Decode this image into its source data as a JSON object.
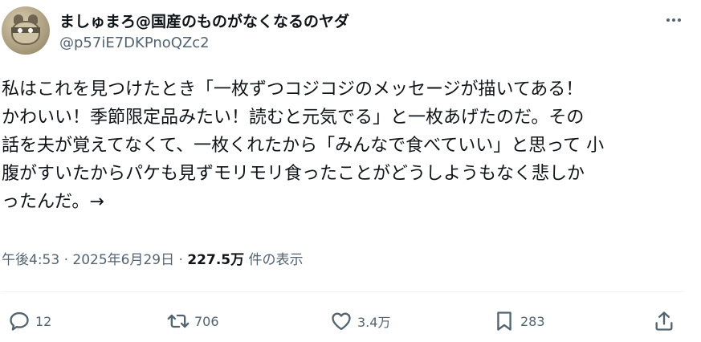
{
  "user": {
    "display_name": "ましゅまろ@国産のものがなくなるのヤダ",
    "handle": "@p57iE7DKPnoQZc2"
  },
  "tweet": {
    "lines": [
      "私はこれを見つけたとき「一枚ずつコジコジのメッセージが描いてある！",
      "かわいい！季節限定品みたい！読むと元気でる」と一枚あげたのだ。その",
      "話を夫が覚えてなくて、一枚くれたから「みんなで食べていい」と思って 小",
      "腹がすいたからパケも見ずモリモリ食ったことがどうしようもなく悲しか",
      "ったんだ。→"
    ]
  },
  "meta": {
    "time": "午後4:53",
    "separator": " · ",
    "date": "2025年6月29日",
    "views_count": "227.5万",
    "views_label": " 件の表示"
  },
  "actions": {
    "reply_count": "12",
    "retweet_count": "706",
    "like_count": "3.4万",
    "bookmark_count": "283"
  },
  "icons": {
    "more": "more-horizontal-icon",
    "reply": "speech-bubble-icon",
    "retweet": "retweet-arrows-icon",
    "like": "heart-icon",
    "bookmark": "bookmark-icon",
    "share": "share-upload-icon"
  },
  "colors": {
    "text": "#0f1419",
    "secondary": "#536471",
    "divider": "#eff3f4",
    "background": "#ffffff"
  }
}
